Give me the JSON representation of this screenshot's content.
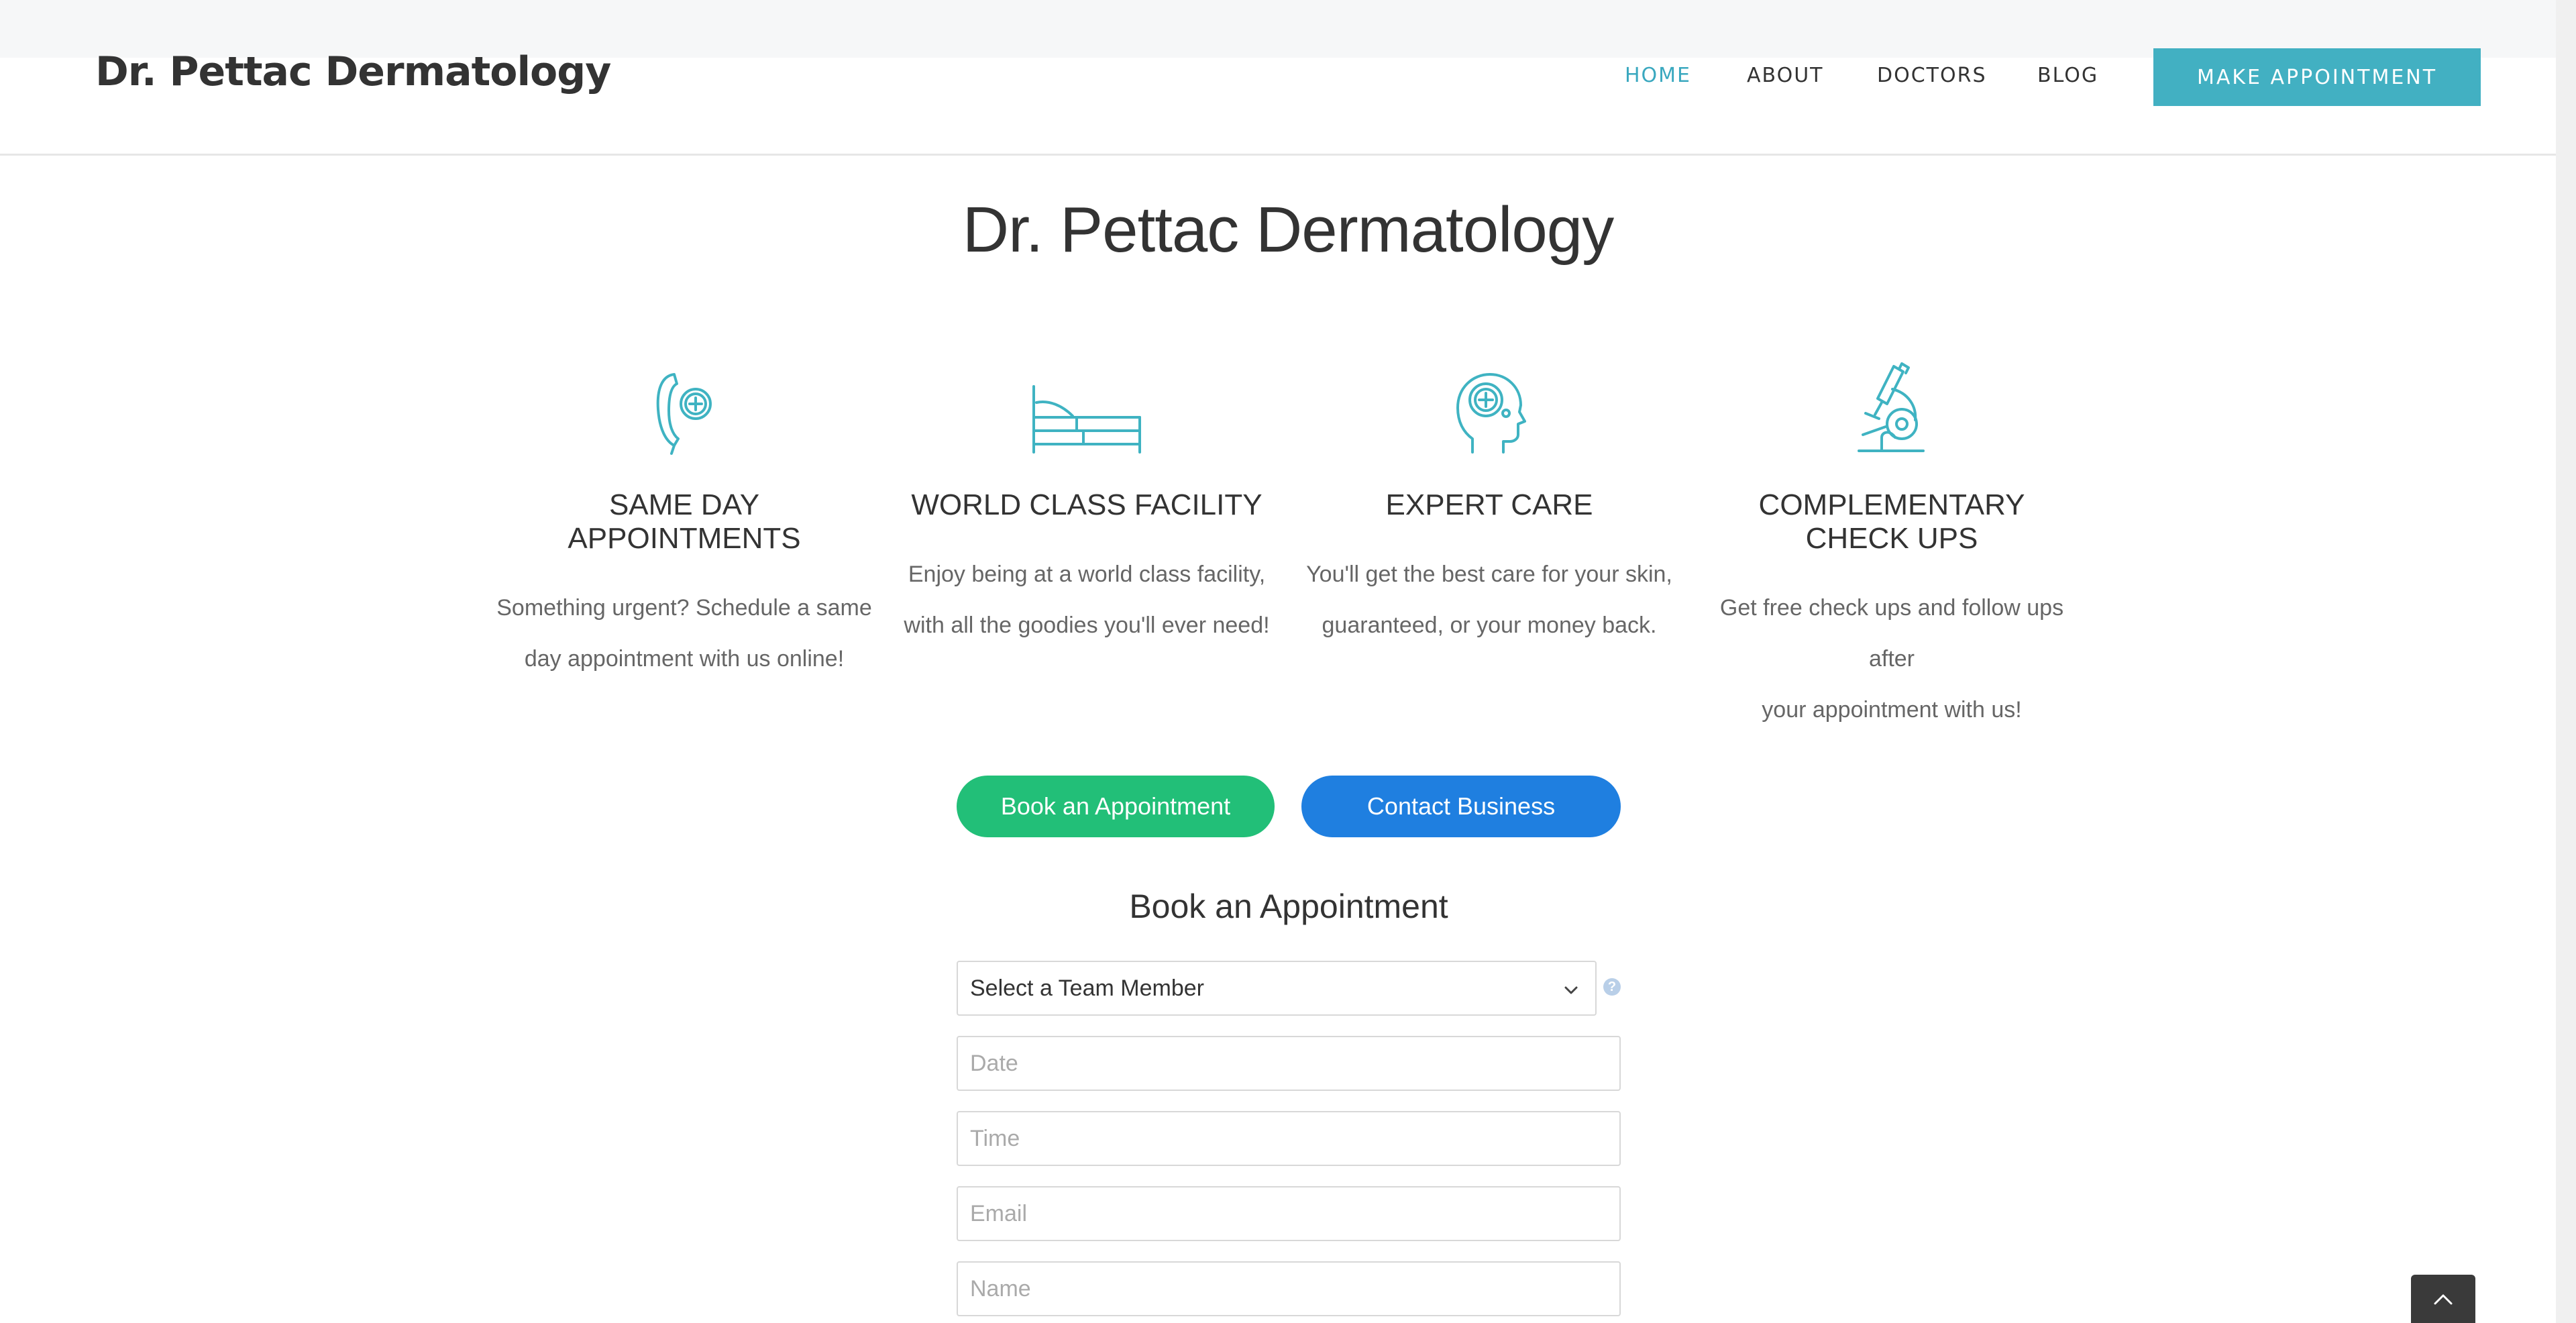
{
  "header": {
    "brand": "Dr. Pettac Dermatology",
    "nav": [
      {
        "label": "HOME",
        "active": true
      },
      {
        "label": "ABOUT",
        "active": false
      },
      {
        "label": "DOCTORS",
        "active": false
      },
      {
        "label": "BLOG",
        "active": false
      }
    ],
    "cta_label": "MAKE APPOINTMENT"
  },
  "hero": {
    "title": "Dr. Pettac Dermatology"
  },
  "features": [
    {
      "icon": "phone-plus-icon",
      "title": "SAME DAY APPOINTMENTS",
      "line1": "Something urgent? Schedule a same",
      "line2": "day appointment with us online!"
    },
    {
      "icon": "bed-icon",
      "title": "WORLD CLASS FACILITY",
      "line1": "Enjoy being at a world class facility,",
      "line2": "with all the goodies you'll ever need!"
    },
    {
      "icon": "head-plus-icon",
      "title": "EXPERT CARE",
      "line1": "You'll get the best care for your skin,",
      "line2": "guaranteed, or your money back."
    },
    {
      "icon": "microscope-icon",
      "title": "COMPLEMENTARY CHECK UPS",
      "line1": "Get free check ups and follow ups after",
      "line2": "your appointment with us!"
    }
  ],
  "buttons": {
    "book": "Book an Appointment",
    "contact": "Contact Business"
  },
  "form": {
    "title": "Book an Appointment",
    "team_member": "Select a Team Member",
    "date_placeholder": "Date",
    "time_placeholder": "Time",
    "email_placeholder": "Email",
    "name_placeholder": "Name",
    "help": "?"
  },
  "colors": {
    "accent": "#42b0c2",
    "icon": "#3fb3c2",
    "green": "#22bf78",
    "blue": "#1f7fe0"
  }
}
